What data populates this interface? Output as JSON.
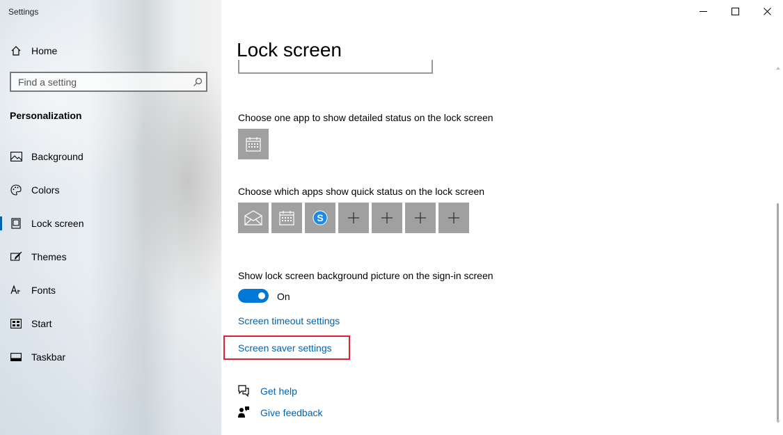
{
  "window": {
    "title": "Settings",
    "controls": [
      "minimize",
      "maximize",
      "close"
    ]
  },
  "sidebar": {
    "home_label": "Home",
    "search_placeholder": "Find a setting",
    "section_title": "Personalization",
    "items": [
      {
        "label": "Background",
        "icon": "picture-icon"
      },
      {
        "label": "Colors",
        "icon": "palette-icon"
      },
      {
        "label": "Lock screen",
        "icon": "lock-screen-icon",
        "active": true
      },
      {
        "label": "Themes",
        "icon": "brush-icon"
      },
      {
        "label": "Fonts",
        "icon": "font-icon"
      },
      {
        "label": "Start",
        "icon": "start-icon"
      },
      {
        "label": "Taskbar",
        "icon": "taskbar-icon"
      }
    ]
  },
  "main": {
    "title": "Lock screen",
    "detailed_status_label": "Choose one app to show detailed status on the lock screen",
    "detailed_status_app": "calendar-icon",
    "quick_status_label": "Choose which apps show quick status on the lock screen",
    "quick_status_apps": [
      "mail-icon",
      "calendar-icon",
      "skype-icon",
      "plus-icon",
      "plus-icon",
      "plus-icon",
      "plus-icon"
    ],
    "signin_background_label": "Show lock screen background picture on the sign-in screen",
    "signin_background_state": "On",
    "screen_timeout_link": "Screen timeout settings",
    "screen_saver_link": "Screen saver settings",
    "get_help": "Get help",
    "give_feedback": "Give feedback"
  },
  "colors": {
    "accent": "#0078d7",
    "link": "#0063b1",
    "highlight": "#e21f2d",
    "tile": "#a0a0a0"
  }
}
